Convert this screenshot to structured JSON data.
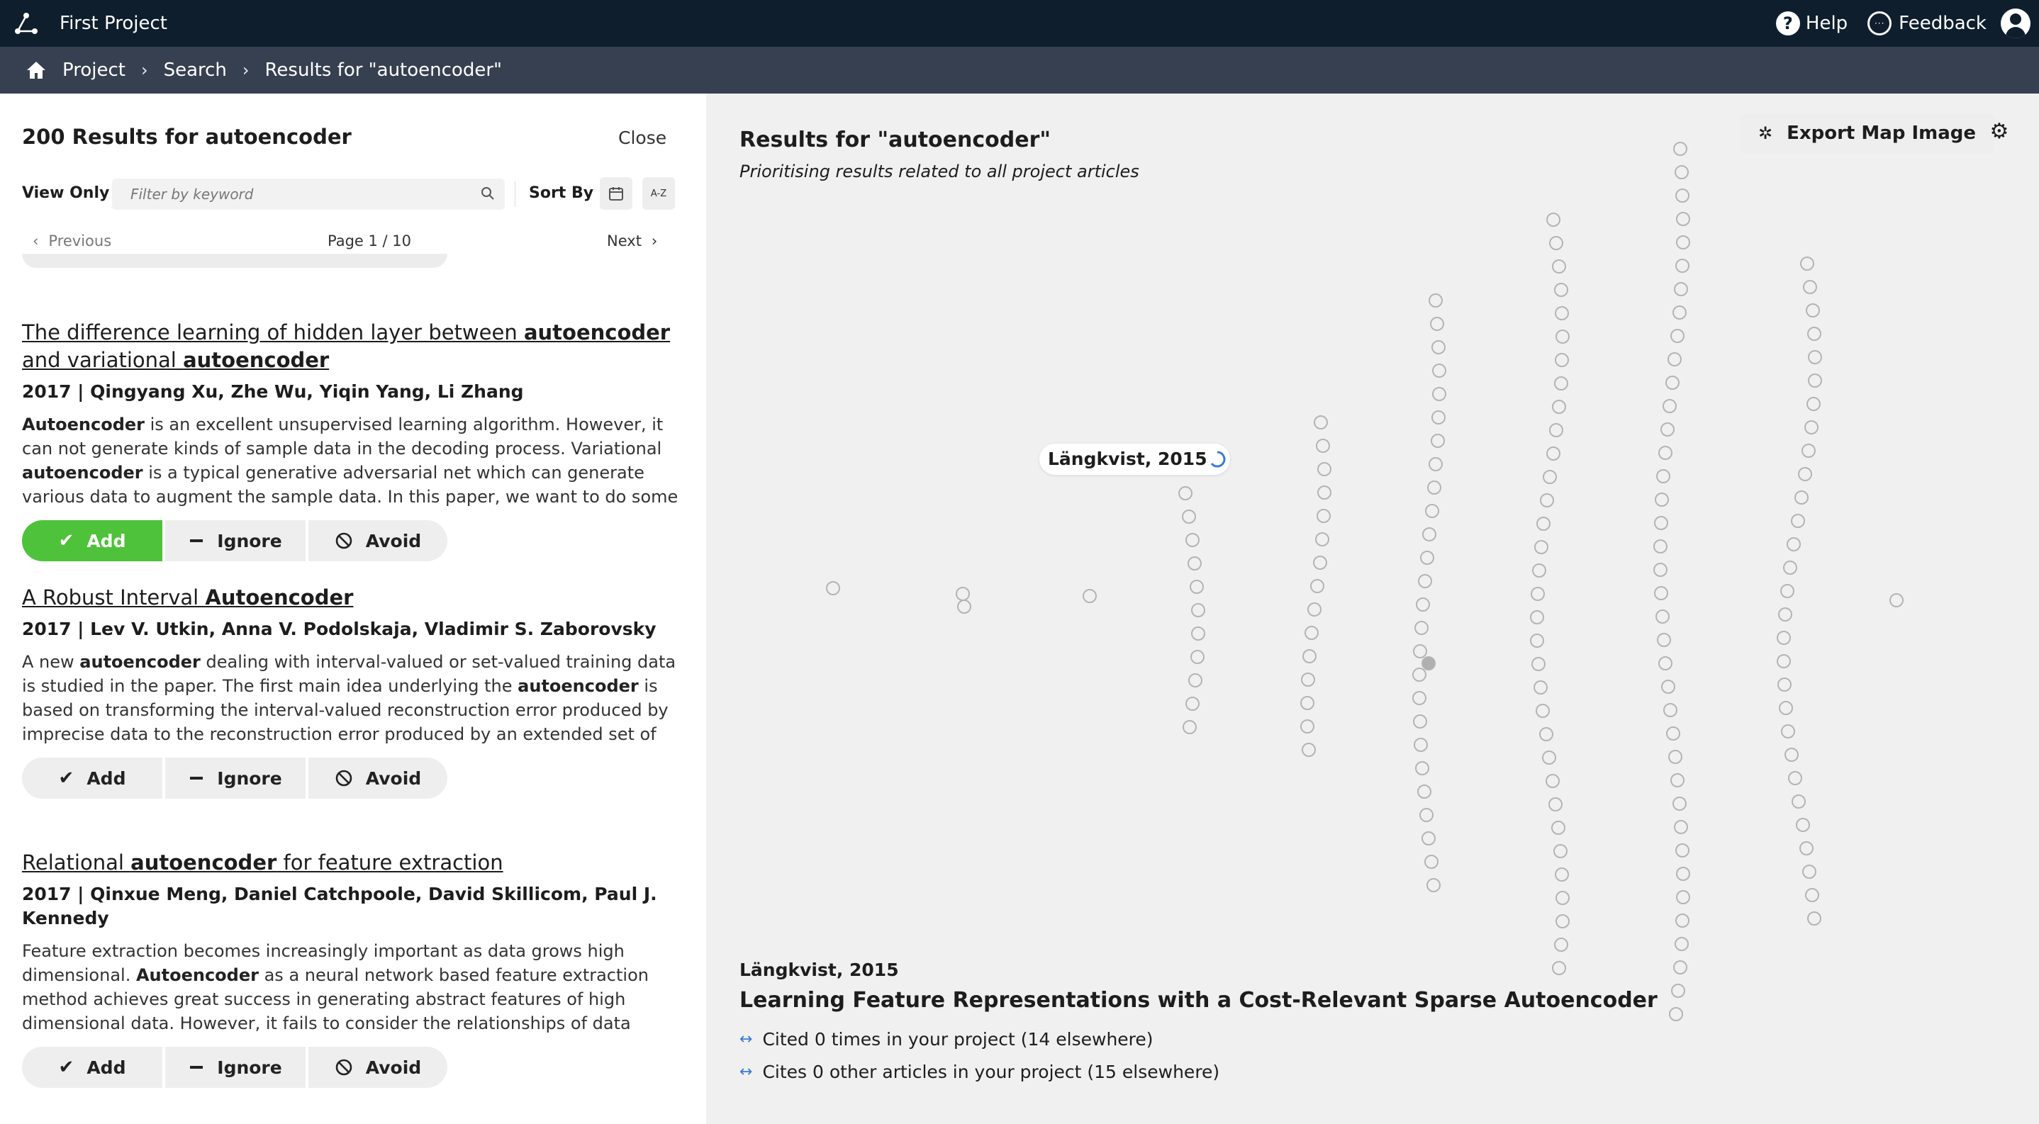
{
  "header": {
    "app_title": "First Project",
    "help_label": "Help",
    "feedback_label": "Feedback"
  },
  "breadcrumb": [
    "Project",
    "Search",
    "Results for \"autoencoder\""
  ],
  "left": {
    "results_title": "200 Results for autoencoder",
    "close_label": "Close",
    "view_only_label": "View Only",
    "filter_placeholder": "Filter by keyword",
    "sort_by_label": "Sort By",
    "sort_az_label": "A-Z",
    "pager": {
      "prev": "Previous",
      "page": "Page 1 / 10",
      "next": "Next"
    },
    "buttons": {
      "add": "Add",
      "ignore": "Ignore",
      "avoid": "Avoid"
    },
    "articles": [
      {
        "title_parts": [
          {
            "t": "The difference learning of hidden layer between ",
            "b": false
          },
          {
            "t": "autoencoder",
            "b": true
          },
          {
            "t": " and variational ",
            "b": false
          },
          {
            "t": "autoencoder",
            "b": true
          }
        ],
        "meta": "2017 | Qingyang Xu, Zhe Wu, Yiqin Yang, Li Zhang",
        "abstract_parts": [
          {
            "t": "Autoencoder",
            "b": true
          },
          {
            "t": " is an excellent unsupervised learning algorithm. However, it can not generate kinds of sample data in the decoding process. Variational ",
            "b": false
          },
          {
            "t": "autoencoder",
            "b": true
          },
          {
            "t": " is a typical generative adversarial net which can generate various data to augment the sample data. In this paper, we want to do some research",
            "b": false
          }
        ],
        "added": true
      },
      {
        "title_parts": [
          {
            "t": "A Robust Interval ",
            "b": false
          },
          {
            "t": "Autoencoder",
            "b": true
          }
        ],
        "meta": "2017 | Lev V. Utkin, Anna V. Podolskaja, Vladimir S. Zaborovsky",
        "abstract_parts": [
          {
            "t": "A new ",
            "b": false
          },
          {
            "t": "autoencoder",
            "b": true
          },
          {
            "t": " dealing with interval-valued or set-valued training data is studied in the paper. The first main idea underlying the ",
            "b": false
          },
          {
            "t": "autoencoder",
            "b": true
          },
          {
            "t": " is based on transforming the interval-valued reconstruction error produced by imprecise data to the reconstruction error produced by an extended set of precise training",
            "b": false
          }
        ],
        "added": false
      },
      {
        "title_parts": [
          {
            "t": "Relational ",
            "b": false
          },
          {
            "t": "autoencoder",
            "b": true
          },
          {
            "t": " for feature extraction",
            "b": false
          }
        ],
        "meta": "2017 | Qinxue Meng, Daniel Catchpoole, David Skillicom, Paul J. Kennedy",
        "abstract_parts": [
          {
            "t": "Feature extraction becomes increasingly important as data grows high dimensional. ",
            "b": false
          },
          {
            "t": "Autoencoder",
            "b": true
          },
          {
            "t": " as a neural network based feature extraction method achieves great success in generating abstract features of high dimensional data. However, it fails to consider the relationships of data samples which may affect",
            "b": false
          }
        ],
        "added": false
      }
    ]
  },
  "map": {
    "title": "Results for \"autoencoder\"",
    "subtitle": "Prioritising results related to all project articles",
    "export_label": "Export Map Image",
    "tooltip": "Längkvist, 2015",
    "detail": {
      "citation": "Längkvist, 2015",
      "title": "Learning Feature Representations with a Cost-Relevant Sparse Autoencoder",
      "cited_line": "Cited 0 times in your project (14 elsewhere)",
      "cites_line": "Cites 0 other articles in your project (15 elsewhere)"
    },
    "colors": {
      "node_stroke": "#b4b4b4",
      "node_selected": "#b0b0b0",
      "add_green": "#4ec23a",
      "arrow_blue": "#3a7bd5"
    }
  }
}
